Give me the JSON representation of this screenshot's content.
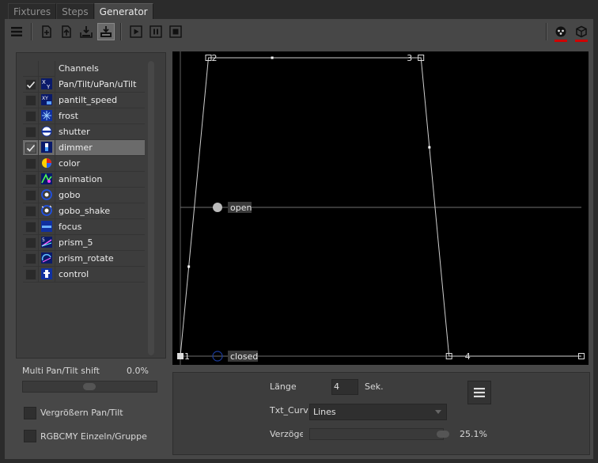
{
  "tabs": [
    {
      "label": "Fixtures",
      "active": false
    },
    {
      "label": "Steps",
      "active": false
    },
    {
      "label": "Generator",
      "active": true
    }
  ],
  "toolbar": {
    "icons": [
      "menu-icon",
      "new-icon",
      "import-icon",
      "export-icon",
      "save-icon",
      "play-icon",
      "pause-icon",
      "stop-icon"
    ],
    "right_icons": [
      "fixture-icon",
      "cube-icon"
    ],
    "accent": "#d00000"
  },
  "channels": {
    "header": "Channels",
    "items": [
      {
        "label": "Pan/Tilt/uPan/uTilt",
        "checked": true,
        "selected": false,
        "icon": "xy-icon"
      },
      {
        "label": "pantilt_speed",
        "checked": false,
        "selected": false,
        "icon": "xy-speed-icon"
      },
      {
        "label": "frost",
        "checked": false,
        "selected": false,
        "icon": "frost-icon"
      },
      {
        "label": "shutter",
        "checked": false,
        "selected": false,
        "icon": "shutter-icon"
      },
      {
        "label": "dimmer",
        "checked": true,
        "selected": true,
        "icon": "dimmer-icon"
      },
      {
        "label": "color",
        "checked": false,
        "selected": false,
        "icon": "color-icon"
      },
      {
        "label": "animation",
        "checked": false,
        "selected": false,
        "icon": "animation-icon"
      },
      {
        "label": "gobo",
        "checked": false,
        "selected": false,
        "icon": "gobo-icon"
      },
      {
        "label": "gobo_shake",
        "checked": false,
        "selected": false,
        "icon": "gobo-shake-icon"
      },
      {
        "label": "focus",
        "checked": false,
        "selected": false,
        "icon": "focus-icon"
      },
      {
        "label": "prism_5",
        "checked": false,
        "selected": false,
        "icon": "prism-icon"
      },
      {
        "label": "prism_rotate",
        "checked": false,
        "selected": false,
        "icon": "prism-rotate-icon"
      },
      {
        "label": "control",
        "checked": false,
        "selected": false,
        "icon": "control-icon"
      }
    ]
  },
  "shift": {
    "label": "Multi Pan/Tilt shift",
    "value": "0.0%",
    "level": 0.5
  },
  "options": [
    {
      "label": "Vergrößern Pan/Tilt",
      "checked": false
    },
    {
      "label": "RGBCMY Einzeln/Gruppe",
      "checked": false
    }
  ],
  "graph": {
    "points": [
      {
        "n": "1",
        "x": 0.0,
        "y": 0.0
      },
      {
        "n": "2",
        "x": 0.07,
        "y": 1.0
      },
      {
        "n": "3",
        "x": 0.6,
        "y": 1.0
      },
      {
        "n": "4",
        "x": 0.67,
        "y": 0.0
      }
    ],
    "end_x": 1.0,
    "open_label": "open",
    "closed_label": "closed"
  },
  "settings": {
    "length_label": "Länge",
    "length_value": "4",
    "length_unit": "Sek.",
    "curve_label": "Txt_Curv",
    "curve_value": "Lines",
    "delay_label": "Verzöger",
    "delay_value": "25.1%",
    "delay_level": 0.251
  }
}
